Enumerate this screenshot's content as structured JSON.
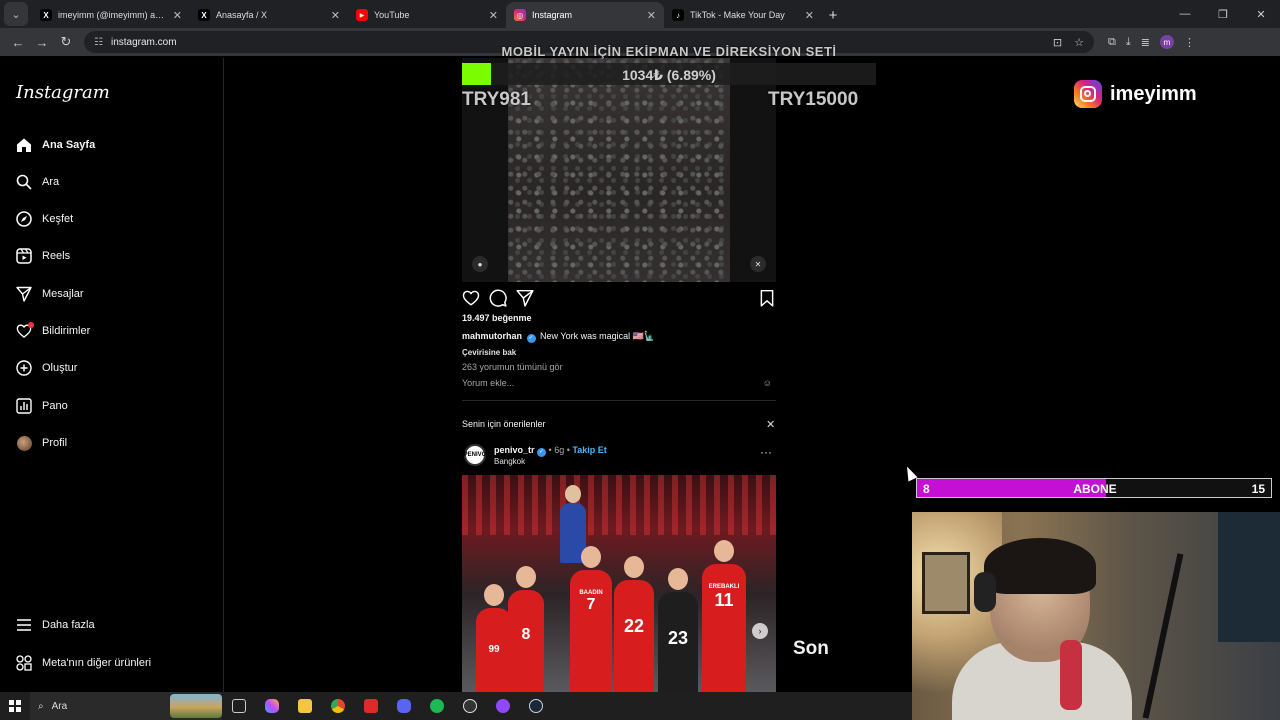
{
  "browser": {
    "tabs": [
      {
        "title": "imeyimm (@imeyimm) adlı kişi",
        "favicon": "X",
        "favicon_color": "#000000"
      },
      {
        "title": "Anasayfa / X",
        "favicon": "X",
        "favicon_color": "#000000"
      },
      {
        "title": "YouTube",
        "favicon": "▶",
        "favicon_color": "#ff0000"
      },
      {
        "title": "Instagram",
        "favicon": "◎",
        "favicon_color": "#d62976"
      },
      {
        "title": "TikTok - Make Your Day",
        "favicon": "♪",
        "favicon_color": "#000000"
      }
    ],
    "url": "instagram.com"
  },
  "sidebar": {
    "logo": "Instagram",
    "items": [
      {
        "label": "Ana Sayfa",
        "icon": "home-icon"
      },
      {
        "label": "Ara",
        "icon": "search-icon"
      },
      {
        "label": "Keşfet",
        "icon": "compass-icon"
      },
      {
        "label": "Reels",
        "icon": "reels-icon"
      },
      {
        "label": "Mesajlar",
        "icon": "send-icon"
      },
      {
        "label": "Bildirimler",
        "icon": "heart-icon"
      },
      {
        "label": "Oluştur",
        "icon": "plus-square-icon"
      },
      {
        "label": "Pano",
        "icon": "dashboard-icon"
      },
      {
        "label": "Profil",
        "icon": "profile-avatar"
      }
    ],
    "bottom": [
      {
        "label": "Daha fazla",
        "icon": "menu-icon"
      },
      {
        "label": "Meta'nın diğer ürünleri",
        "icon": "grid-icon"
      }
    ]
  },
  "post1": {
    "likes": "19.497 beğenme",
    "username": "mahmutorhan",
    "caption": "New York was magical 🇺🇸🗽",
    "translate": "Çevirisine bak",
    "comments": "263 yorumun tümünü gör",
    "add_comment": "Yorum ekle..."
  },
  "suggestions": {
    "title": "Senin için önerilenler",
    "username": "penivo_tr",
    "time": "6g",
    "follow": "Takip Et",
    "location": "Bangkok",
    "jersey_numbers": [
      "8",
      "7",
      "22",
      "23",
      "11",
      "99"
    ],
    "jersey_names": [
      "BAADIN",
      "EREBAKLI"
    ]
  },
  "overlay": {
    "goal_title": "MOBİL YAYIN İÇİN EKİPMAN VE DİREKSİYON SETİ",
    "goal_amount": "1034₺ (6.89%)",
    "goal_progress": 0.0689,
    "goal_min": "TRY981",
    "goal_max": "TRY15000",
    "ig_handle": "imeyimm",
    "sub_current": "8",
    "sub_label": "ABONE",
    "sub_goal": "15",
    "sub_progress": 0.533,
    "caption_text": "Son"
  },
  "taskbar": {
    "search": "Ara"
  }
}
